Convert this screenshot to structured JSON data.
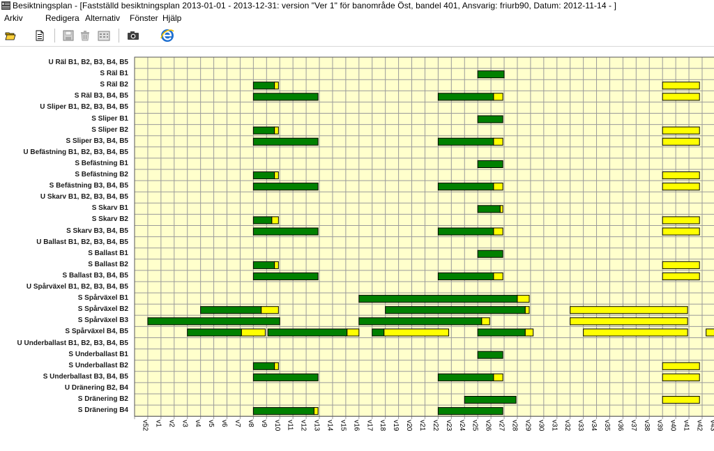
{
  "window": {
    "title": "Besiktningsplan - [Fastställd besiktningsplan 2013-01-01 - 2013-12-31: version \"Ver 1\" för banområde Öst, bandel 401, Ansvarig: friurb90, Datum: 2012-11-14 - ]"
  },
  "menu": {
    "items": [
      "Arkiv",
      "Redigera",
      "Alternativ",
      "Fönster",
      "Hjälp"
    ]
  },
  "toolbar": {
    "buttons": [
      "open-folder-icon",
      "new-document-icon",
      "save-icon",
      "delete-icon",
      "calendar-icon",
      "camera-icon",
      "internet-explorer-icon"
    ]
  },
  "colors": {
    "plot_background": "#ffffcc",
    "grid": "#9a9a9a",
    "bar_done": "#008000",
    "bar_remaining": "#ffff00",
    "bar_border": "#000000"
  },
  "chart_data": {
    "type": "gantt",
    "weeks": [
      "v52",
      "v1",
      "v2",
      "v3",
      "v4",
      "v5",
      "v6",
      "v7",
      "v8",
      "v9",
      "v10",
      "v11",
      "v12",
      "v13",
      "v14",
      "v15",
      "v16",
      "v17",
      "v18",
      "v19",
      "v20",
      "v21",
      "v22",
      "v23",
      "v24",
      "v25",
      "v26",
      "v27",
      "v28",
      "v29",
      "v30",
      "v31",
      "v32",
      "v33",
      "v34",
      "v35",
      "v36",
      "v37",
      "v38",
      "v39",
      "v40",
      "v41",
      "v42",
      "v43",
      "v44"
    ],
    "rows": [
      {
        "label": "U Räl B1, B2, B3, B4, B5",
        "bars": []
      },
      {
        "label": "S Räl B1",
        "bars": [
          {
            "start": 26,
            "done": 2,
            "rem": 0
          }
        ]
      },
      {
        "label": "S Räl B2",
        "bars": [
          {
            "start": 9,
            "done": 1.6,
            "rem": 0.3
          },
          {
            "start": 40,
            "done": 0,
            "rem": 2.8
          }
        ]
      },
      {
        "label": "S Räl B3, B4, B5",
        "bars": [
          {
            "start": 9,
            "done": 4.9,
            "rem": 0
          },
          {
            "start": 23,
            "done": 4.2,
            "rem": 0.7
          },
          {
            "start": 40,
            "done": 0,
            "rem": 2.8
          }
        ]
      },
      {
        "label": "U Sliper B1, B2, B3, B4, B5",
        "bars": []
      },
      {
        "label": "S Sliper B1",
        "bars": [
          {
            "start": 26,
            "done": 1.9,
            "rem": 0
          }
        ]
      },
      {
        "label": "S Sliper B2",
        "bars": [
          {
            "start": 9,
            "done": 1.6,
            "rem": 0.3
          },
          {
            "start": 40,
            "done": 0,
            "rem": 2.8
          }
        ]
      },
      {
        "label": "S Sliper B3, B4, B5",
        "bars": [
          {
            "start": 9,
            "done": 4.9,
            "rem": 0
          },
          {
            "start": 23,
            "done": 4.2,
            "rem": 0.7
          },
          {
            "start": 40,
            "done": 0,
            "rem": 2.8
          }
        ]
      },
      {
        "label": "U Befästning B1, B2, B3, B4, B5",
        "bars": []
      },
      {
        "label": "S Befästning B1",
        "bars": [
          {
            "start": 26,
            "done": 1.9,
            "rem": 0
          }
        ]
      },
      {
        "label": "S Befästning B2",
        "bars": [
          {
            "start": 9,
            "done": 1.6,
            "rem": 0.3
          },
          {
            "start": 40,
            "done": 0,
            "rem": 2.8
          }
        ]
      },
      {
        "label": "S Befästning B3, B4, B5",
        "bars": [
          {
            "start": 9,
            "done": 4.9,
            "rem": 0
          },
          {
            "start": 23,
            "done": 4.2,
            "rem": 0.7
          },
          {
            "start": 40,
            "done": 0,
            "rem": 2.8
          }
        ]
      },
      {
        "label": "U Skarv B1, B2, B3, B4, B5",
        "bars": []
      },
      {
        "label": "S Skarv B1",
        "bars": [
          {
            "start": 26,
            "done": 1.7,
            "rem": 0.2
          }
        ]
      },
      {
        "label": "S Skarv B2",
        "bars": [
          {
            "start": 9,
            "done": 1.4,
            "rem": 0.5
          },
          {
            "start": 40,
            "done": 0,
            "rem": 2.8
          }
        ]
      },
      {
        "label": "S Skarv B3, B4, B5",
        "bars": [
          {
            "start": 9,
            "done": 4.9,
            "rem": 0
          },
          {
            "start": 23,
            "done": 4.2,
            "rem": 0.7
          },
          {
            "start": 40,
            "done": 0,
            "rem": 2.8
          }
        ]
      },
      {
        "label": "U Ballast B1, B2, B3, B4, B5",
        "bars": []
      },
      {
        "label": "S Ballast B1",
        "bars": [
          {
            "start": 26,
            "done": 1.9,
            "rem": 0
          }
        ]
      },
      {
        "label": "S Ballast B2",
        "bars": [
          {
            "start": 9,
            "done": 1.6,
            "rem": 0.3
          },
          {
            "start": 40,
            "done": 0,
            "rem": 2.8
          }
        ]
      },
      {
        "label": "S Ballast B3, B4, B5",
        "bars": [
          {
            "start": 9,
            "done": 4.9,
            "rem": 0
          },
          {
            "start": 23,
            "done": 4.2,
            "rem": 0.7
          },
          {
            "start": 40,
            "done": 0,
            "rem": 2.8
          }
        ]
      },
      {
        "label": "U Spårväxel B1, B2, B3, B4, B5",
        "bars": []
      },
      {
        "label": "S Spårväxel B1",
        "bars": [
          {
            "start": 17,
            "done": 12,
            "rem": 0.9
          }
        ]
      },
      {
        "label": "S Spårväxel B2",
        "bars": [
          {
            "start": 5,
            "done": 4.6,
            "rem": 1.3
          },
          {
            "start": 19,
            "done": 10.6,
            "rem": 0.3
          },
          {
            "start": 33,
            "done": 0,
            "rem": 8.9
          }
        ]
      },
      {
        "label": "S Spårväxel B3",
        "bars": [
          {
            "start": 1,
            "done": 10,
            "rem": 0
          },
          {
            "start": 17,
            "done": 9.3,
            "rem": 0.6
          },
          {
            "start": 33,
            "done": 0,
            "rem": 8.9
          }
        ]
      },
      {
        "label": "S Spårväxel B4, B5",
        "bars": [
          {
            "start": 4,
            "done": 4.1,
            "rem": 1.8
          },
          {
            "start": 10.1,
            "done": 6,
            "rem": 0.9
          },
          {
            "start": 18,
            "done": 0.9,
            "rem": 4.9
          },
          {
            "start": 26,
            "done": 3.6,
            "rem": 0.6
          },
          {
            "start": 34,
            "done": 0,
            "rem": 7.9
          },
          {
            "start": 43.3,
            "done": 0,
            "rem": 0.9
          }
        ]
      },
      {
        "label": "U Underballast B1, B2, B3, B4, B5",
        "bars": []
      },
      {
        "label": "S Underballast B1",
        "bars": [
          {
            "start": 26,
            "done": 1.9,
            "rem": 0
          }
        ]
      },
      {
        "label": "S Underballast B2",
        "bars": [
          {
            "start": 9,
            "done": 1.6,
            "rem": 0.3
          },
          {
            "start": 40,
            "done": 0,
            "rem": 2.8
          }
        ]
      },
      {
        "label": "S Underballast B3, B4, B5",
        "bars": [
          {
            "start": 9,
            "done": 4.9,
            "rem": 0
          },
          {
            "start": 23,
            "done": 4.2,
            "rem": 0.7
          },
          {
            "start": 40,
            "done": 0,
            "rem": 2.8
          }
        ]
      },
      {
        "label": "U Dränering B2, B4",
        "bars": []
      },
      {
        "label": "S Dränering B2",
        "bars": [
          {
            "start": 25,
            "done": 3.9,
            "rem": 0
          },
          {
            "start": 40,
            "done": 0,
            "rem": 2.8
          }
        ]
      },
      {
        "label": "S Dränering B4",
        "bars": [
          {
            "start": 9,
            "done": 4.6,
            "rem": 0.3
          },
          {
            "start": 23,
            "done": 4.9,
            "rem": 0
          }
        ]
      }
    ]
  }
}
